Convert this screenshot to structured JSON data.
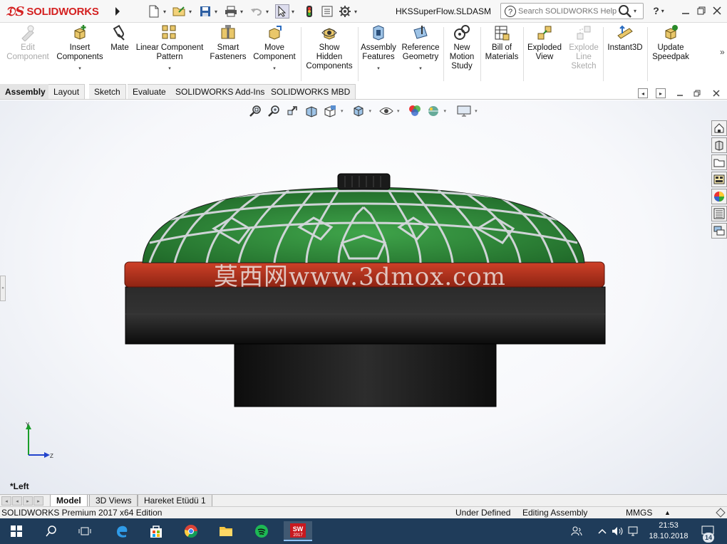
{
  "app": {
    "brand": "SOLIDWORKS",
    "document_title": "HKSSuperFlow.SLDASM"
  },
  "search": {
    "placeholder": "Search SOLIDWORKS Help"
  },
  "help": {
    "label": "?"
  },
  "ribbon": {
    "items": [
      {
        "label1": "Edit",
        "label2": "Component",
        "label3": "",
        "icon": "edit-component-icon",
        "disabled": true,
        "dropdown": false
      },
      {
        "label1": "Insert",
        "label2": "Components",
        "label3": "",
        "icon": "insert-components-icon",
        "disabled": false,
        "dropdown": true
      },
      {
        "label1": "Mate",
        "label2": "",
        "label3": "",
        "icon": "mate-icon",
        "disabled": false,
        "dropdown": false
      },
      {
        "label1": "Linear Component",
        "label2": "Pattern",
        "label3": "",
        "icon": "linear-pattern-icon",
        "disabled": false,
        "dropdown": true
      },
      {
        "label1": "Smart",
        "label2": "Fasteners",
        "label3": "",
        "icon": "smart-fasteners-icon",
        "disabled": false,
        "dropdown": false
      },
      {
        "label1": "Move",
        "label2": "Component",
        "label3": "",
        "icon": "move-component-icon",
        "disabled": false,
        "dropdown": true
      },
      {
        "label1": "Show",
        "label2": "Hidden",
        "label3": "Components",
        "icon": "show-hidden-icon",
        "disabled": false,
        "dropdown": false
      },
      {
        "label1": "Assembly",
        "label2": "Features",
        "label3": "",
        "icon": "assembly-features-icon",
        "disabled": false,
        "dropdown": true
      },
      {
        "label1": "Reference",
        "label2": "Geometry",
        "label3": "",
        "icon": "reference-geometry-icon",
        "disabled": false,
        "dropdown": true
      },
      {
        "label1": "New",
        "label2": "Motion",
        "label3": "Study",
        "icon": "motion-study-icon",
        "disabled": false,
        "dropdown": false
      },
      {
        "label1": "Bill of",
        "label2": "Materials",
        "label3": "",
        "icon": "bom-icon",
        "disabled": false,
        "dropdown": false
      },
      {
        "label1": "Exploded",
        "label2": "View",
        "label3": "",
        "icon": "exploded-view-icon",
        "disabled": false,
        "dropdown": false
      },
      {
        "label1": "Explode",
        "label2": "Line",
        "label3": "Sketch",
        "icon": "explode-line-icon",
        "disabled": true,
        "dropdown": false
      },
      {
        "label1": "Instant3D",
        "label2": "",
        "label3": "",
        "icon": "instant3d-icon",
        "disabled": false,
        "dropdown": false
      },
      {
        "label1": "Update",
        "label2": "Speedpak",
        "label3": "",
        "icon": "speedpak-icon",
        "disabled": false,
        "dropdown": false
      }
    ],
    "more": "»"
  },
  "tabs": [
    {
      "label": "Assembly",
      "active": true
    },
    {
      "label": "Layout",
      "active": false
    },
    {
      "label": "Sketch",
      "active": false
    },
    {
      "label": "Evaluate",
      "active": false
    },
    {
      "label": "SOLIDWORKS Add-Ins",
      "active": false
    },
    {
      "label": "SOLIDWORKS MBD",
      "active": false
    }
  ],
  "viewport": {
    "watermark": "莫西网www.3dmox.com",
    "view_label": "*Left",
    "triad": {
      "y_label": "Y",
      "z_label": "Z"
    }
  },
  "model_tabs": [
    {
      "label": "Model",
      "active": true
    },
    {
      "label": "3D Views",
      "active": false
    },
    {
      "label": "Hareket Etüdü 1",
      "active": false
    }
  ],
  "status": {
    "edition": "SOLIDWORKS Premium 2017 x64 Edition",
    "definition": "Under Defined",
    "mode": "Editing Assembly",
    "units": "MMGS",
    "units_caret": "▲"
  },
  "taskbar": {
    "time": "21:53",
    "date": "18.10.2018",
    "notifications": "14",
    "sw_badge": "2017"
  },
  "colors": {
    "filter_green": "#2f8a3a",
    "flange_red": "#b3301c",
    "body_black": "#1a1a1a",
    "brand_red": "#d42121",
    "taskbar": "#1f3c5a"
  }
}
